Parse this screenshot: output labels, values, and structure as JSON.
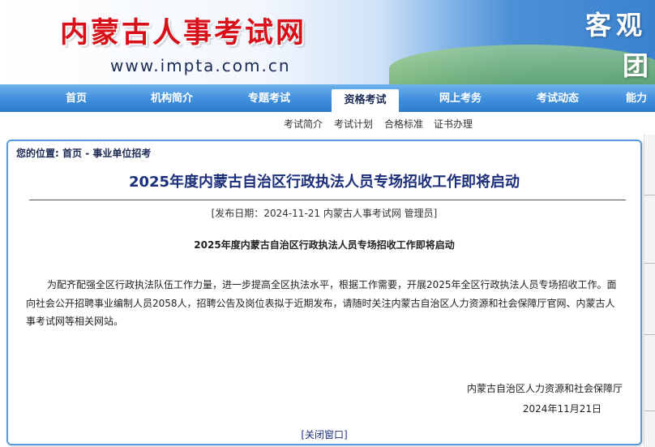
{
  "header": {
    "logo_text": "内蒙古人事考试网",
    "url_text": "www.impta.com.cn",
    "slogan_line1": "客观",
    "slogan_line2": "团"
  },
  "nav": {
    "items": [
      "首页",
      "机构简介",
      "专题考试",
      "资格考试",
      "网上考务",
      "考试动态",
      "能力"
    ],
    "active": "资格考试"
  },
  "subnav": {
    "items": [
      "考试简介",
      "考试计划",
      "合格标准",
      "证书办理"
    ]
  },
  "breadcrumb": {
    "label": "您的位置:",
    "home": "首页",
    "separator": " - ",
    "section": "事业单位招考"
  },
  "article": {
    "title": "2025年度内蒙古自治区行政执法人员专场招收工作即将启动",
    "meta": "[发布日期：2024-11-21 内蒙古人事考试网 管理员]",
    "subtitle": "2025年度内蒙古自治区行政执法人员专场招收工作即将启动",
    "body": "为配齐配强全区行政执法队伍工作力量，进一步提高全区执法水平，根据工作需要，开展2025年全区行政执法人员专场招收工作。面向社会公开招聘事业编制人员2058人，招聘公告及岗位表拟于近期发布，请随时关注内蒙古自治区人力资源和社会保障厅官网、内蒙古人事考试网等相关网站。",
    "signer": "内蒙古自治区人力资源和社会保障厅",
    "date": "2024年11月21日",
    "close_label": "[关闭窗口]"
  },
  "colors": {
    "logo_red": "#d8101a",
    "nav_blue": "#3f8fdc",
    "title_blue": "#1c2f7a",
    "panel_border": "#5a98dd"
  }
}
